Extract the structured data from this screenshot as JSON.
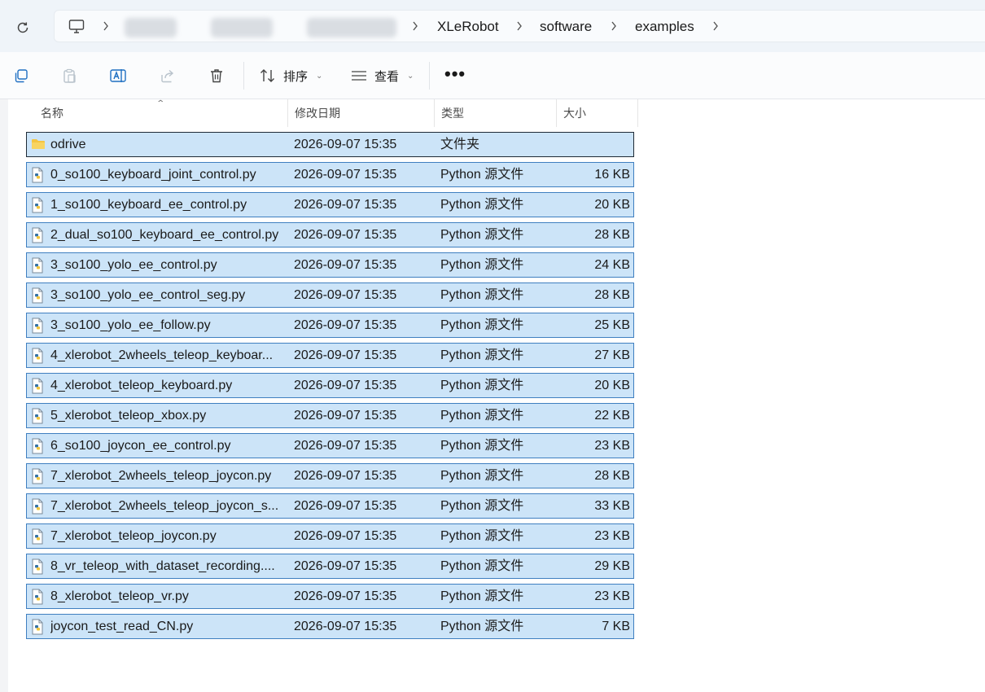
{
  "breadcrumb": {
    "items": [
      "XLeRobot",
      "software",
      "examples"
    ]
  },
  "toolbar": {
    "sort_label": "排序",
    "view_label": "查看",
    "more_label": "•••"
  },
  "columns": {
    "name": "名称",
    "date": "修改日期",
    "type": "类型",
    "size": "大小"
  },
  "files": [
    {
      "name": "odrive",
      "date": "2026-09-07 15:35",
      "type": "文件夹",
      "size": "",
      "kind": "folder"
    },
    {
      "name": "0_so100_keyboard_joint_control.py",
      "date": "2026-09-07 15:35",
      "type": "Python 源文件",
      "size": "16 KB",
      "kind": "python"
    },
    {
      "name": "1_so100_keyboard_ee_control.py",
      "date": "2026-09-07 15:35",
      "type": "Python 源文件",
      "size": "20 KB",
      "kind": "python"
    },
    {
      "name": "2_dual_so100_keyboard_ee_control.py",
      "date": "2026-09-07 15:35",
      "type": "Python 源文件",
      "size": "28 KB",
      "kind": "python"
    },
    {
      "name": "3_so100_yolo_ee_control.py",
      "date": "2026-09-07 15:35",
      "type": "Python 源文件",
      "size": "24 KB",
      "kind": "python"
    },
    {
      "name": "3_so100_yolo_ee_control_seg.py",
      "date": "2026-09-07 15:35",
      "type": "Python 源文件",
      "size": "28 KB",
      "kind": "python"
    },
    {
      "name": "3_so100_yolo_ee_follow.py",
      "date": "2026-09-07 15:35",
      "type": "Python 源文件",
      "size": "25 KB",
      "kind": "python"
    },
    {
      "name": "4_xlerobot_2wheels_teleop_keyboar...",
      "date": "2026-09-07 15:35",
      "type": "Python 源文件",
      "size": "27 KB",
      "kind": "python"
    },
    {
      "name": "4_xlerobot_teleop_keyboard.py",
      "date": "2026-09-07 15:35",
      "type": "Python 源文件",
      "size": "20 KB",
      "kind": "python"
    },
    {
      "name": "5_xlerobot_teleop_xbox.py",
      "date": "2026-09-07 15:35",
      "type": "Python 源文件",
      "size": "22 KB",
      "kind": "python"
    },
    {
      "name": "6_so100_joycon_ee_control.py",
      "date": "2026-09-07 15:35",
      "type": "Python 源文件",
      "size": "23 KB",
      "kind": "python"
    },
    {
      "name": "7_xlerobot_2wheels_teleop_joycon.py",
      "date": "2026-09-07 15:35",
      "type": "Python 源文件",
      "size": "28 KB",
      "kind": "python"
    },
    {
      "name": "7_xlerobot_2wheels_teleop_joycon_s...",
      "date": "2026-09-07 15:35",
      "type": "Python 源文件",
      "size": "33 KB",
      "kind": "python"
    },
    {
      "name": "7_xlerobot_teleop_joycon.py",
      "date": "2026-09-07 15:35",
      "type": "Python 源文件",
      "size": "23 KB",
      "kind": "python"
    },
    {
      "name": "8_vr_teleop_with_dataset_recording....",
      "date": "2026-09-07 15:35",
      "type": "Python 源文件",
      "size": "29 KB",
      "kind": "python"
    },
    {
      "name": "8_xlerobot_teleop_vr.py",
      "date": "2026-09-07 15:35",
      "type": "Python 源文件",
      "size": "23 KB",
      "kind": "python"
    },
    {
      "name": "joycon_test_read_CN.py",
      "date": "2026-09-07 15:35",
      "type": "Python 源文件",
      "size": "7 KB",
      "kind": "python"
    }
  ],
  "colors": {
    "selection_fill": "#cce4f8",
    "selection_border": "#3f7fc0",
    "folder": "#f4c542"
  }
}
